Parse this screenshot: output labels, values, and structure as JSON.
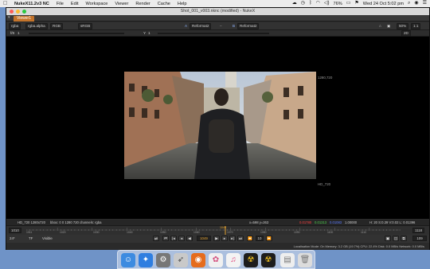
{
  "menubar": {
    "apple": "",
    "app_name": "NukeX11.2v3 NC",
    "items": [
      "File",
      "Edit",
      "Workspace",
      "Viewer",
      "Render",
      "Cache",
      "Help"
    ],
    "battery": "76%",
    "clock": "Wed 24 Oct  5:02 pm"
  },
  "window": {
    "title": "Shot_001_v003.nknc (modified) - NukeX",
    "tab": "Viewer1"
  },
  "toolbar": {
    "channels": "rgba",
    "layer": "rgba.alpha",
    "colorspace": "RGB",
    "lut": "sRGB",
    "input_a": "Reformat2",
    "input_b": "Reformat2",
    "zoom": "50%",
    "proxy": "1:1",
    "mode_2d": "2D",
    "gain_label": "f/8",
    "gain_value": "1",
    "gamma_label": "Y",
    "gamma_value": "1"
  },
  "viewer": {
    "format_top": "1280,720",
    "format_bottom": "HD_720"
  },
  "infobar": {
    "format": "HD_720 1280x720",
    "bbox": "bbox: 0 0 1280 720 channels: rgba",
    "coords": "x=598 y=263",
    "r": "0.01780",
    "g": "0.01313",
    "b": "0.01083",
    "a": "1.00000",
    "hsvl": "H: 20 S:0.39 V:0.02  L: 0.01396"
  },
  "timeline": {
    "start": "1010",
    "end": "1118",
    "ticks": [
      "1011",
      "1020",
      "1030",
      "1040",
      "1050",
      "1060",
      "1070",
      "1080",
      "1090",
      "1100",
      "1110"
    ],
    "current_marker": "1049"
  },
  "playbar": {
    "fps": "24*",
    "tf": "TF",
    "range": "Visible",
    "current_frame": "1049",
    "increment": "10",
    "end_frame": "109"
  },
  "statusline": "Localisation Mode: On   Memory: 3.2 GB (19.7%)  CPU: 22.4%  Disk: 0.0 MB/s  Network: 0.0 MB/s",
  "dock": {
    "apps": [
      "finder-icon",
      "safari-icon",
      "system-preferences-icon",
      "rocket-icon",
      "firefox-icon",
      "photos-icon",
      "itunes-icon",
      "nuke-icon",
      "nuke-icon",
      "document-icon",
      "trash-icon"
    ]
  },
  "colors": {
    "tab_accent": "#c4742b",
    "red_channel": "#ff4040",
    "green_channel": "#4cd04c",
    "blue_channel": "#5a7bff"
  }
}
